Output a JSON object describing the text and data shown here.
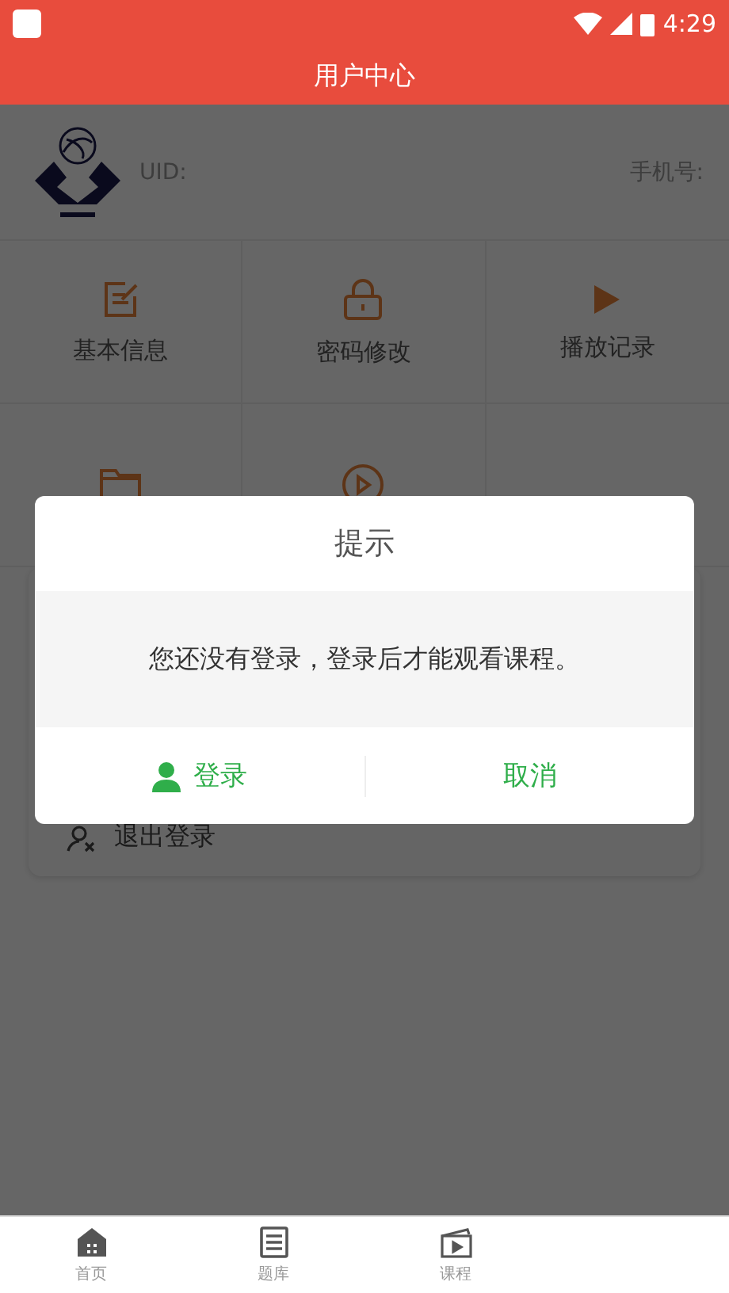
{
  "status_bar": {
    "time": "4:29"
  },
  "header": {
    "title": "用户中心"
  },
  "profile": {
    "uid_label": "UID:",
    "phone_label": "手机号:"
  },
  "features": [
    {
      "kind": "edit",
      "label": "基本信息"
    },
    {
      "kind": "lock",
      "label": "密码修改"
    },
    {
      "kind": "play",
      "label": "播放记录"
    },
    {
      "kind": "folder"
    },
    {
      "kind": "play-circle"
    }
  ],
  "menu": [
    {
      "kind": "logout",
      "label": "退出登录"
    }
  ],
  "dialog": {
    "title": "提示",
    "message": "您还没有登录，登录后才能观看课程。",
    "buttons": [
      {
        "kind": "login",
        "label": "登录"
      },
      {
        "kind": "cancel",
        "label": "取消"
      }
    ]
  },
  "bottom_nav": [
    {
      "kind": "home",
      "label": "首页"
    },
    {
      "kind": "list",
      "label": "题库"
    },
    {
      "kind": "video",
      "label": "课程"
    }
  ]
}
